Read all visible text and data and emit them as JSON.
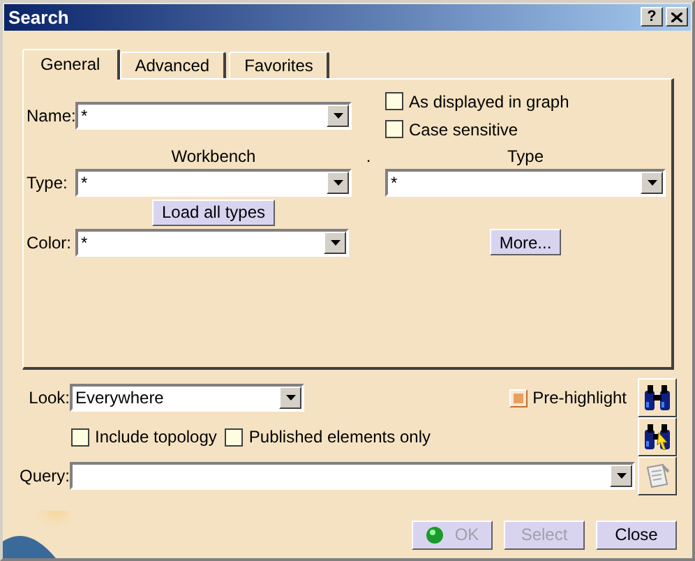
{
  "window": {
    "title": "Search",
    "help_button": "?"
  },
  "tabs": [
    {
      "label": "General",
      "selected": true
    },
    {
      "label": "Advanced",
      "selected": false
    },
    {
      "label": "Favorites",
      "selected": false
    }
  ],
  "general": {
    "name": {
      "label": "Name:",
      "value": "*"
    },
    "as_displayed_in_graph": {
      "label": "As displayed in graph",
      "checked": false
    },
    "case_sensitive": {
      "label": "Case sensitive",
      "checked": false
    },
    "workbench_heading": "Workbench",
    "separator": ".",
    "type_heading": "Type",
    "type": {
      "label": "Type:",
      "workbench_value": "*",
      "type_value": "*"
    },
    "load_all_types_button": "Load all types",
    "color": {
      "label": "Color:",
      "value": "*"
    },
    "more_button": "More..."
  },
  "look": {
    "label": "Look:",
    "value": "Everywhere"
  },
  "pre_highlight": {
    "label": "Pre-highlight",
    "checked": true
  },
  "include_topology": {
    "label": "Include topology",
    "checked": false
  },
  "published_elements_only": {
    "label": "Published elements only",
    "checked": false
  },
  "query": {
    "label": "Query:"
  },
  "buttons": [
    {
      "label": "OK",
      "kind": "ok",
      "disabled": true
    },
    {
      "label": "Select",
      "kind": "plain",
      "disabled": true
    },
    {
      "label": "Close",
      "kind": "plain",
      "disabled": false
    }
  ]
}
